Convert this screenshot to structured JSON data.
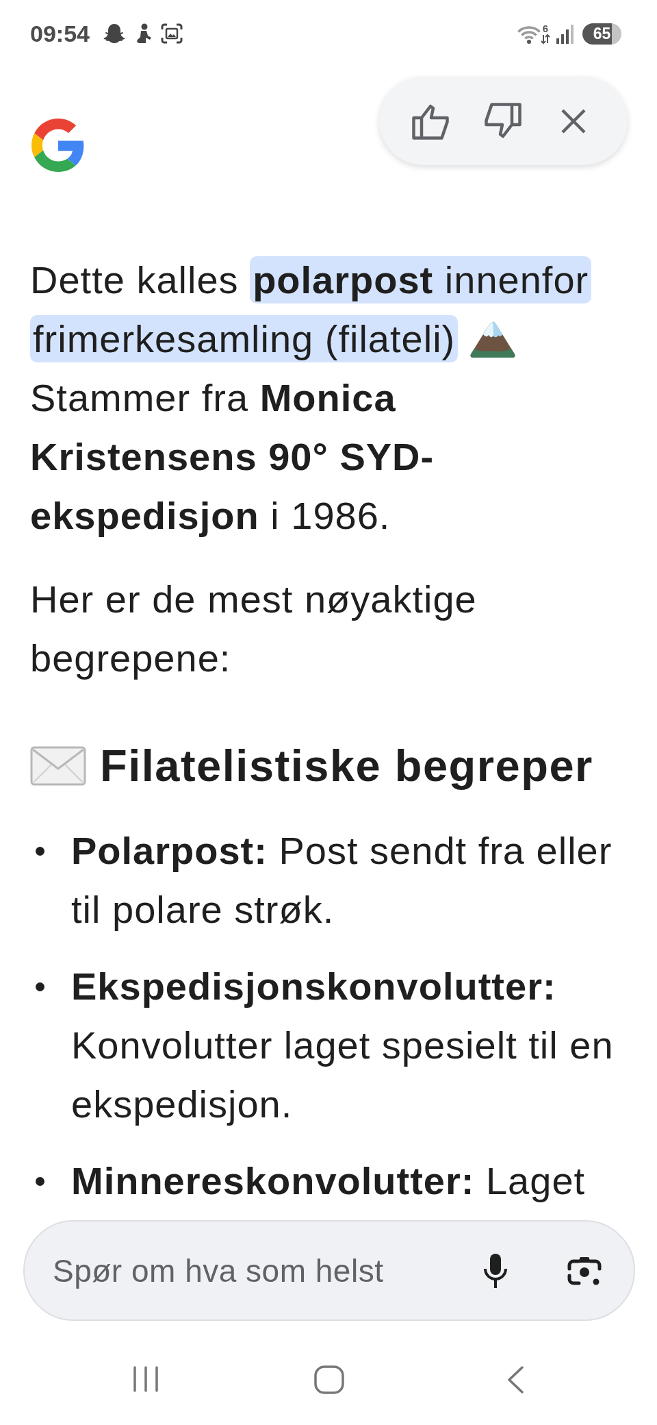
{
  "status_bar": {
    "time": "09:54",
    "network": "6",
    "battery": "65"
  },
  "feedback": {
    "liked": false,
    "disliked": false
  },
  "answer": [
    {
      "kind": "lead",
      "lines": [
        {
          "runs": [
            {
              "text": "Dette kalles ",
              "highlighted": false
            },
            {
              "text": "**polarpost** innenfor",
              "highlighted": true
            }
          ]
        },
        {
          "runs": [
            {
              "text": "frimerkesamling (filateli)",
              "highlighted": true
            }
          ]
        }
      ],
      "follow": "Stammer fra **Monica Kristensens 90° SYD-ekspedisjon** i 1986."
    },
    {
      "kind": "paragraph",
      "text": "Her er de mest nøyaktige begrepene:"
    },
    {
      "kind": "heading",
      "text": "Filatelistiske begreper"
    },
    {
      "kind": "bullets",
      "items": [
        "**Polarpost:** Post sendt fra eller til polare strøk.",
        "**Ekspedisjonskonvolutter:** Konvolutter laget spesielt til en ekspedisjon.",
        "**Minnereskonvolutter:** Laget"
      ]
    }
  ],
  "composer": {
    "placeholder": "Spør om hva som helst"
  }
}
